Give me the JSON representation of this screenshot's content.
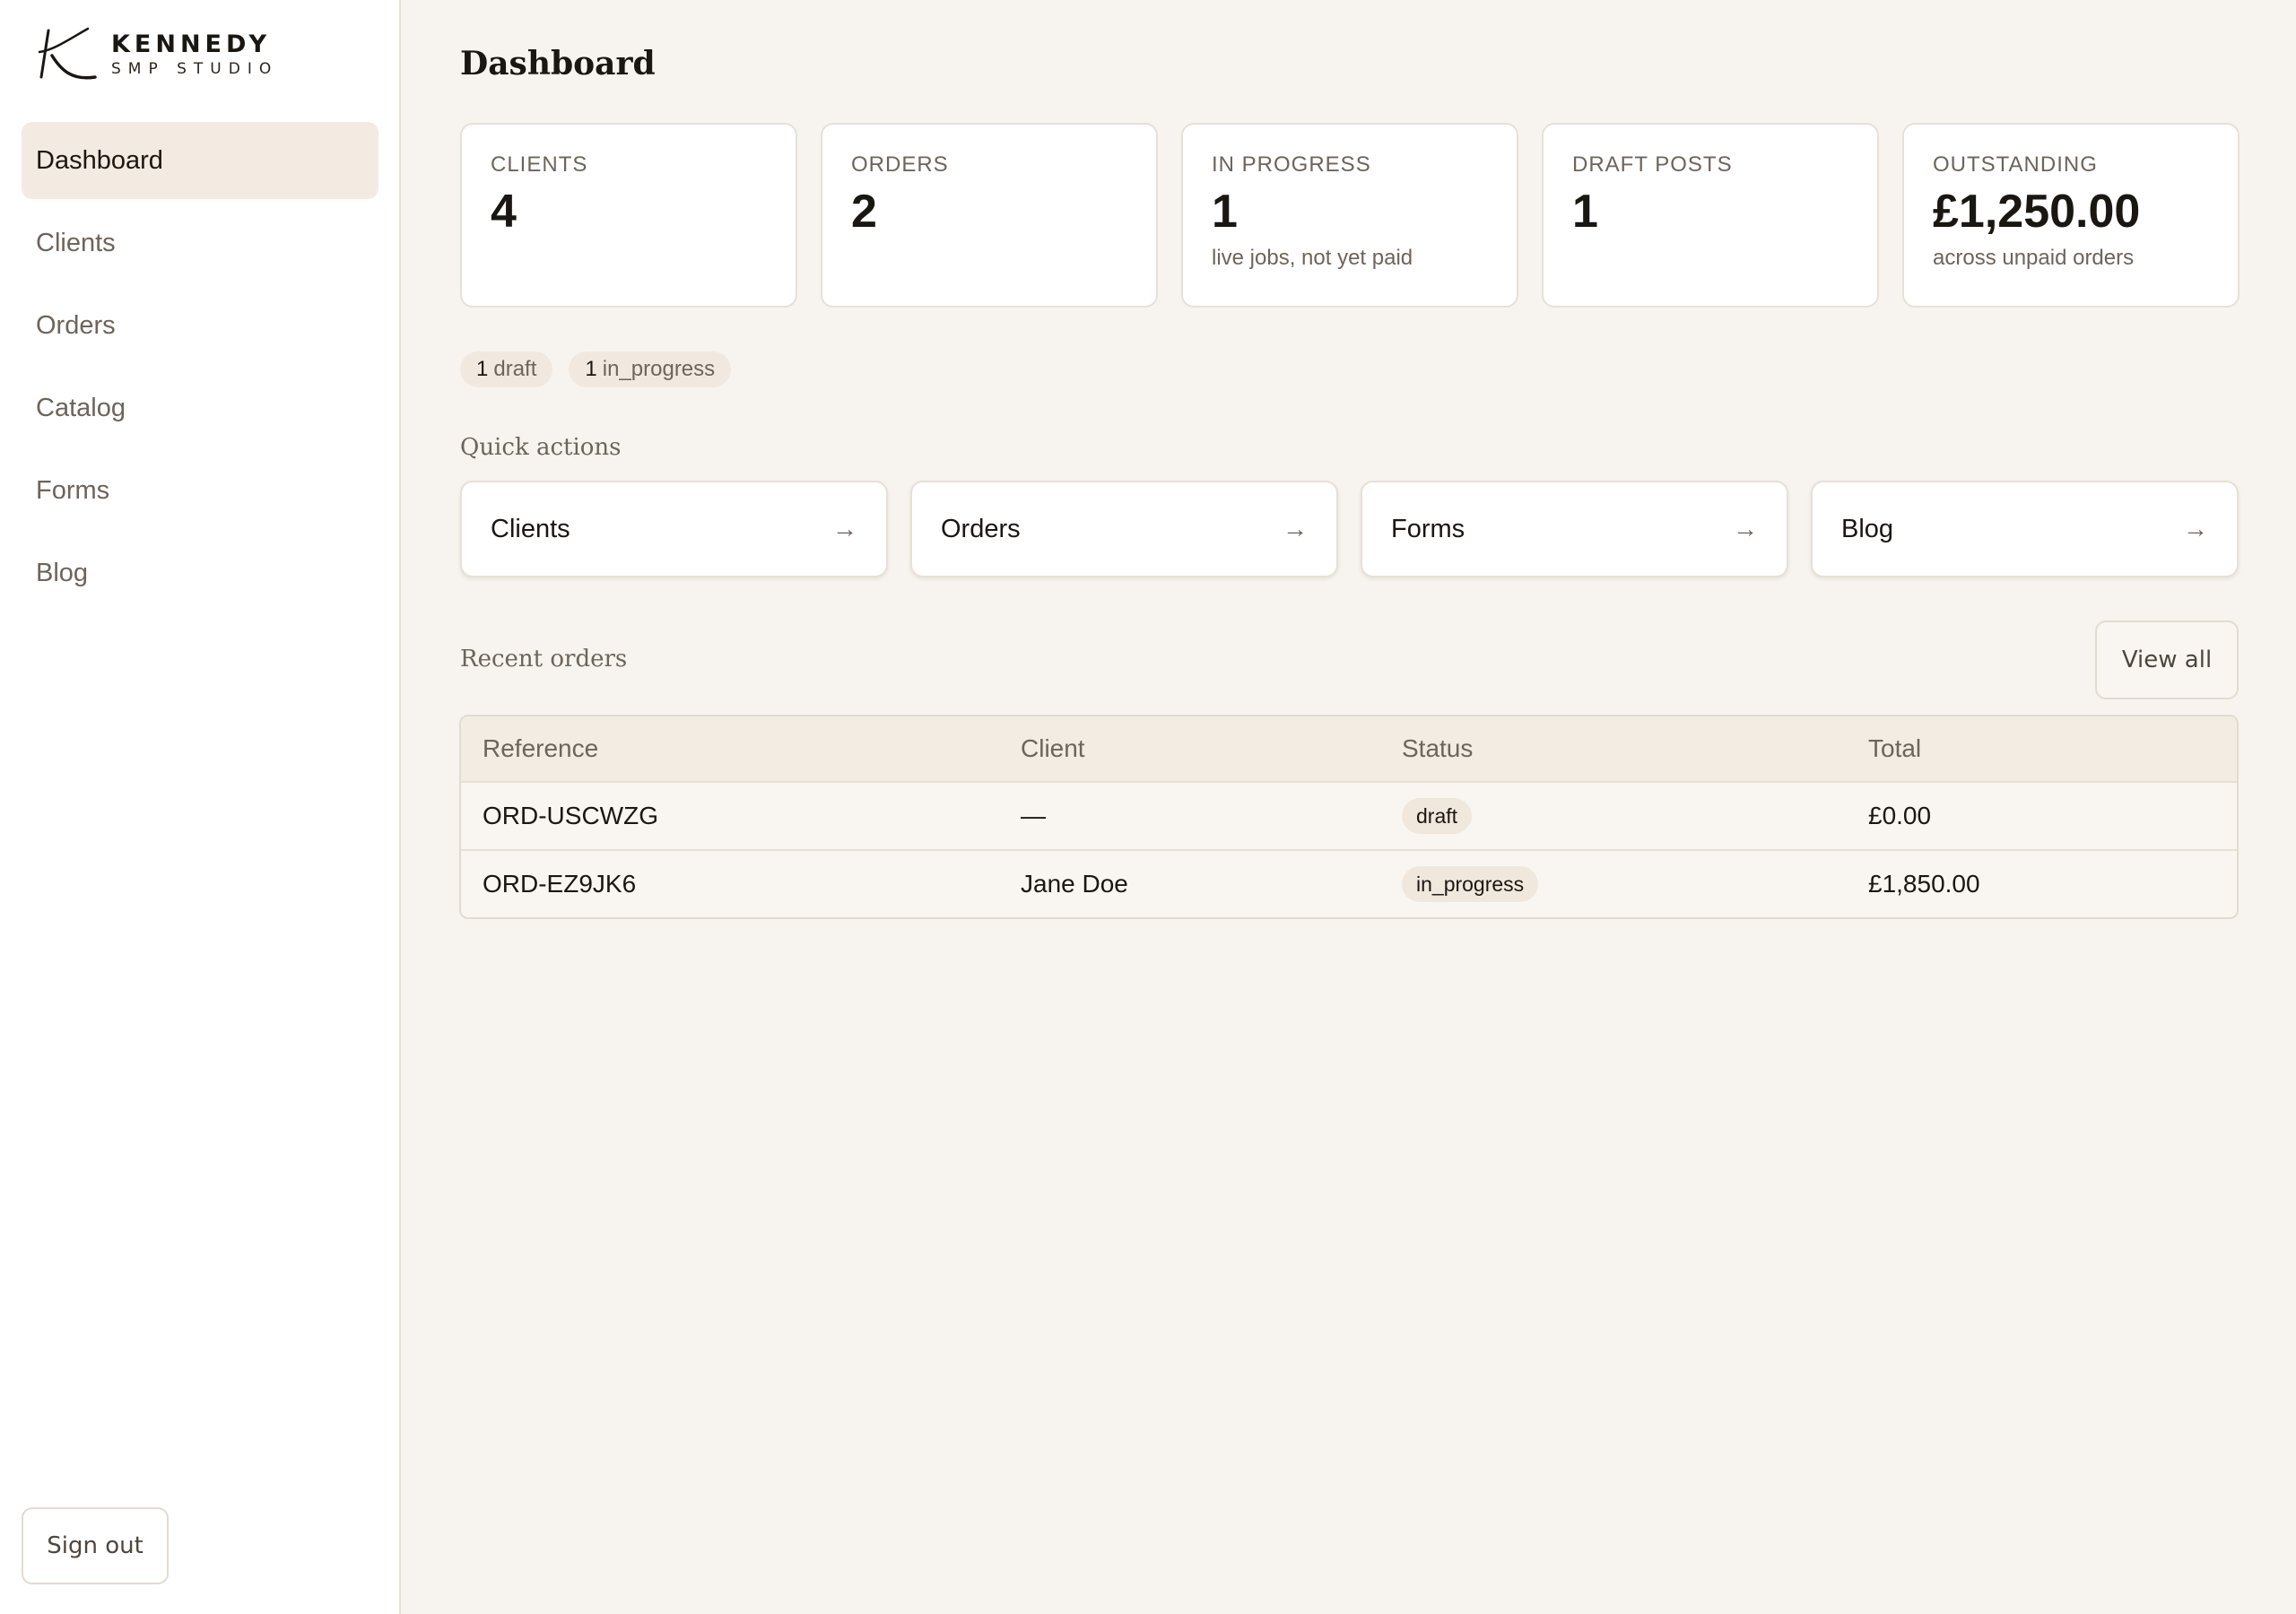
{
  "brand": {
    "name": "KENNEDY",
    "sub": "SMP STUDIO"
  },
  "sidebar": {
    "items": [
      {
        "label": "Dashboard",
        "active": true
      },
      {
        "label": "Clients"
      },
      {
        "label": "Orders"
      },
      {
        "label": "Catalog"
      },
      {
        "label": "Forms"
      },
      {
        "label": "Blog"
      }
    ],
    "signout_label": "Sign out"
  },
  "page": {
    "title": "Dashboard"
  },
  "stats": [
    {
      "label": "CLIENTS",
      "value": "4",
      "sub": ""
    },
    {
      "label": "ORDERS",
      "value": "2",
      "sub": ""
    },
    {
      "label": "IN PROGRESS",
      "value": "1",
      "sub": "live jobs, not yet paid"
    },
    {
      "label": "DRAFT POSTS",
      "value": "1",
      "sub": ""
    },
    {
      "label": "OUTSTANDING",
      "value": "£1,250.00",
      "sub": "across unpaid orders"
    }
  ],
  "status_pills": [
    {
      "count": "1",
      "label": "draft"
    },
    {
      "count": "1",
      "label": "in_progress"
    }
  ],
  "quick_actions": {
    "title": "Quick actions",
    "items": [
      {
        "label": "Clients",
        "icon": "arrow-right-icon"
      },
      {
        "label": "Orders",
        "icon": "arrow-right-icon"
      },
      {
        "label": "Forms",
        "icon": "arrow-right-icon"
      },
      {
        "label": "Blog",
        "icon": "arrow-right-icon"
      }
    ]
  },
  "recent_orders": {
    "title": "Recent orders",
    "view_all_label": "View all",
    "columns": [
      "Reference",
      "Client",
      "Status",
      "Total"
    ],
    "rows": [
      {
        "reference": "ORD-USCWZG",
        "client": "—",
        "status": "draft",
        "total": "£0.00"
      },
      {
        "reference": "ORD-EZ9JK6",
        "client": "Jane Doe",
        "status": "in_progress",
        "total": "£1,850.00"
      }
    ]
  },
  "colors": {
    "background": "#f7f4ef",
    "active_nav": "#f3ebe2",
    "badge": "#f0e8dd"
  }
}
